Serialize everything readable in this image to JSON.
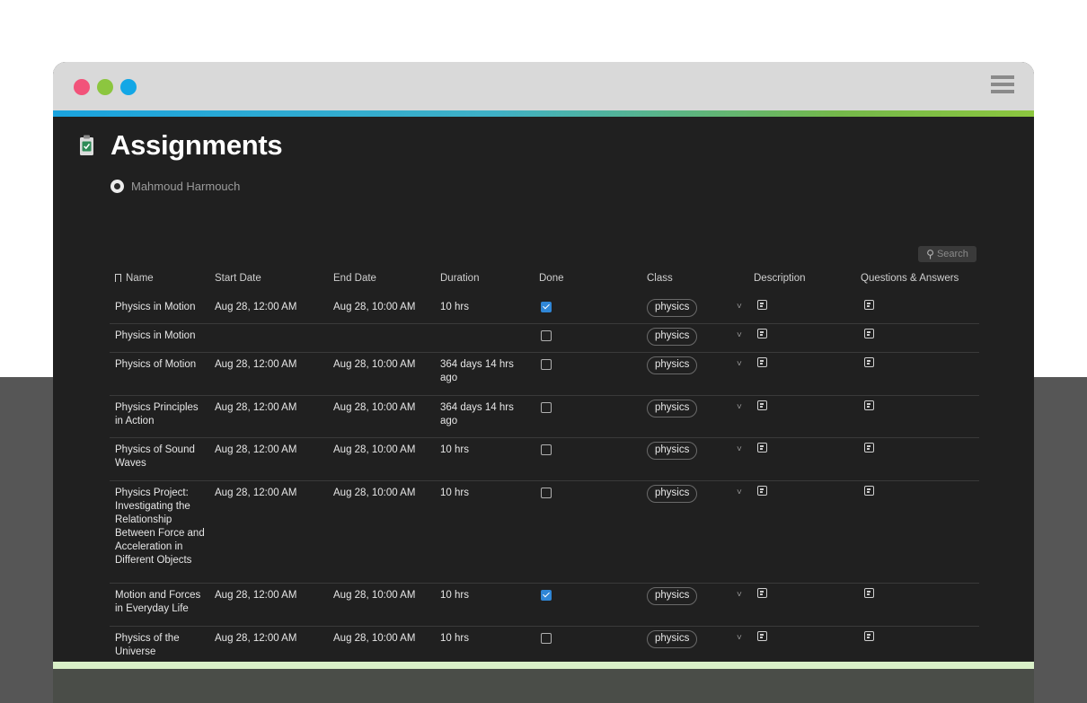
{
  "page": {
    "title": "Assignments",
    "author": "Mahmoud Harmouch"
  },
  "search": {
    "label": "Search"
  },
  "table": {
    "columns": [
      "Name",
      "Start Date",
      "End Date",
      "Duration",
      "Done",
      "Class",
      "Description",
      "Questions & Answers"
    ],
    "rows": [
      {
        "name": "Physics in Motion",
        "start": "Aug 28, 12:00 AM",
        "end": "Aug 28, 10:00 AM",
        "duration": "10 hrs",
        "done": true,
        "class": "physics"
      },
      {
        "name": "Physics in Motion",
        "start": "",
        "end": "",
        "duration": "",
        "done": false,
        "class": "physics"
      },
      {
        "name": "Physics of Motion",
        "start": "Aug 28, 12:00 AM",
        "end": "Aug 28, 10:00 AM",
        "duration": "364 days 14 hrs ago",
        "done": false,
        "class": "physics"
      },
      {
        "name": "Physics Principles in Action",
        "start": "Aug 28, 12:00 AM",
        "end": "Aug 28, 10:00 AM",
        "duration": "364 days 14 hrs ago",
        "done": false,
        "class": "physics"
      },
      {
        "name": "Physics of Sound Waves",
        "start": "Aug 28, 12:00 AM",
        "end": "Aug 28, 10:00 AM",
        "duration": "10 hrs",
        "done": false,
        "class": "physics"
      },
      {
        "name": "Physics Project: Investigating the Relationship Between Force and Acceleration in Different Objects",
        "start": "Aug 28, 12:00 AM",
        "end": "Aug 28, 10:00 AM",
        "duration": "10 hrs",
        "done": false,
        "class": "physics"
      },
      {
        "name": "Motion and Forces in Everyday Life",
        "start": "Aug 28, 12:00 AM",
        "end": "Aug 28, 10:00 AM",
        "duration": "10 hrs",
        "done": true,
        "class": "physics"
      },
      {
        "name": "Physics of the Universe",
        "start": "Aug 28, 12:00 AM",
        "end": "Aug 28, 10:00 AM",
        "duration": "10 hrs",
        "done": false,
        "class": "physics"
      }
    ]
  },
  "colors": {
    "accent_blue": "#1aa3df",
    "accent_green": "#8cc63f",
    "checkbox_on": "#2f86d6"
  }
}
